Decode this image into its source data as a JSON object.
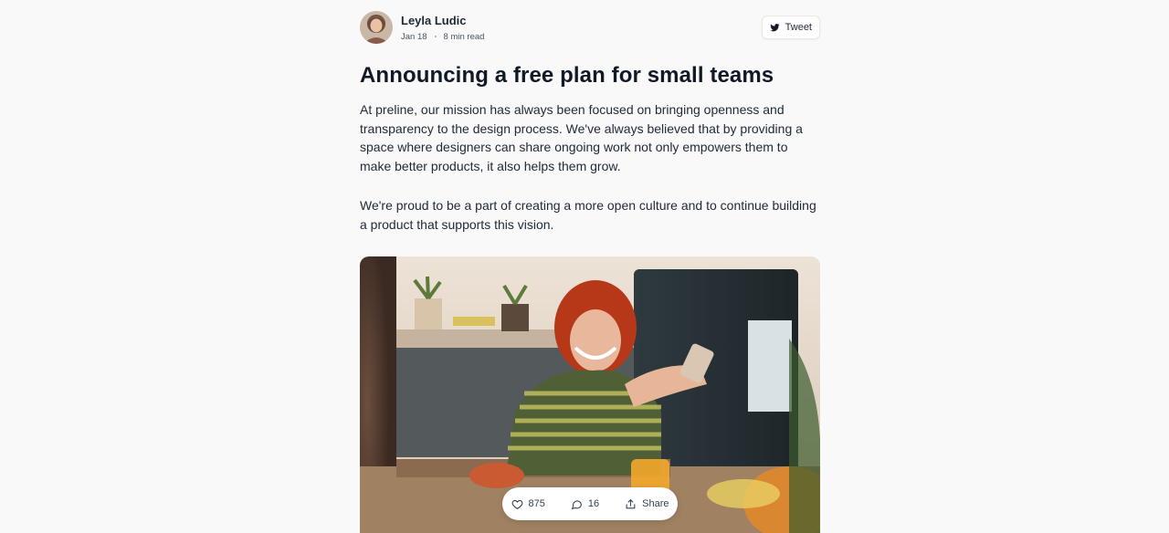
{
  "author": {
    "name": "Leyla Ludic",
    "date": "Jan 18",
    "read_time": "8 min read"
  },
  "tweet_button": {
    "label": "Tweet",
    "icon": "twitter-icon"
  },
  "article": {
    "title": "Announcing a free plan for small teams",
    "paragraphs": [
      "At preline, our mission has always been focused on bringing openness and transparency to the design process. We've always believed that by providing a space where designers can share ongoing work not only empowers them to make better products, it also helps them grow.",
      "We're proud to be a part of creating a more open culture and to continue building a product that supports this vision."
    ]
  },
  "actions": {
    "likes": "875",
    "comments": "16",
    "share_label": "Share",
    "icons": [
      "heart-icon",
      "comment-icon",
      "share-icon"
    ]
  }
}
